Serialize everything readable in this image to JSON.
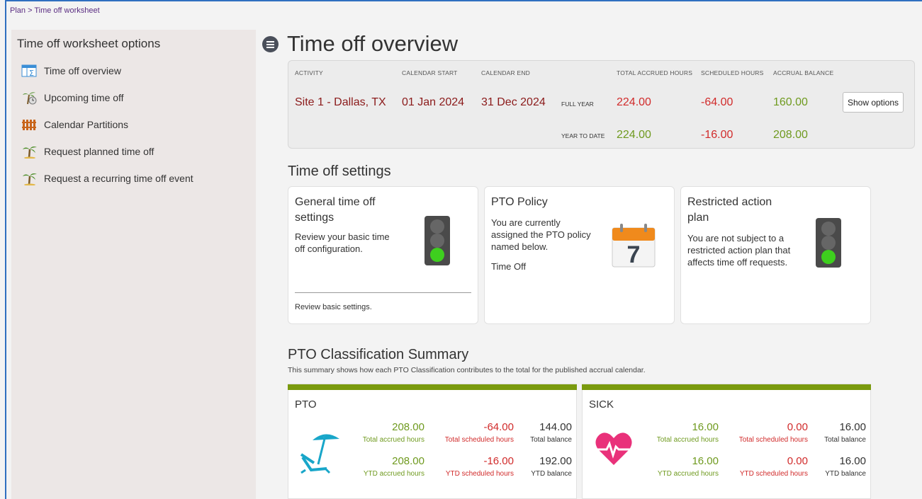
{
  "breadcrumb": "Plan > Time off worksheet",
  "sidebar": {
    "title": "Time off worksheet options",
    "items": [
      {
        "label": "Time off overview",
        "icon": "overview-table-icon"
      },
      {
        "label": "Upcoming time off",
        "icon": "palm-clock-icon"
      },
      {
        "label": "Calendar Partitions",
        "icon": "fence-icon"
      },
      {
        "label": "Request planned time off",
        "icon": "palm-tree-icon"
      },
      {
        "label": "Request a recurring time off event",
        "icon": "palm-tree-icon"
      }
    ]
  },
  "main": {
    "title": "Time off overview",
    "overview": {
      "headers": {
        "activity": "ACTIVITY",
        "calendar_start": "CALENDAR START",
        "calendar_end": "CALENDAR END",
        "total_accrued": "TOTAL ACCRUED HOURS",
        "scheduled": "SCHEDULED HOURS",
        "accrual_balance": "ACCRUAL BALANCE"
      },
      "activity": "Site 1 - Dallas, TX",
      "calendar_start": "01 Jan 2024",
      "calendar_end": "31 Dec 2024",
      "full_year": {
        "label": "FULL YEAR",
        "accrued": "224.00",
        "scheduled": "-64.00",
        "balance": "160.00"
      },
      "year_to_date": {
        "label": "YEAR TO DATE",
        "accrued": "224.00",
        "scheduled": "-16.00",
        "balance": "208.00"
      },
      "show_options": "Show options"
    },
    "settings": {
      "title": "Time off settings",
      "cards": [
        {
          "title_line1": "General time off",
          "title_line2": "settings",
          "desc_line1": "Review your basic time",
          "desc_line2": "off configuration.",
          "link": "Review basic settings.",
          "icon": "traffic-light-icon"
        },
        {
          "title": "PTO Policy",
          "desc_line1": "You are currently",
          "desc_line2": "assigned the PTO policy",
          "desc_line3": "named below.",
          "extra": "Time Off",
          "icon": "calendar-icon",
          "calendar_day": "7"
        },
        {
          "title_line1": "Restricted action",
          "title_line2": "plan",
          "desc_line1": "You are not subject to a",
          "desc_line2": "restricted action plan that",
          "desc_line3": "affects time off requests.",
          "icon": "traffic-light-icon"
        }
      ]
    },
    "classification": {
      "title": "PTO Classification Summary",
      "subtitle": "This summary shows how each PTO Classification contributes to the total for the published accrual calendar.",
      "accent": "#7a9a0e",
      "cards": [
        {
          "name": "PTO",
          "icon": "beach-umbrella-icon",
          "total_accrued": "208.00",
          "total_scheduled": "-64.00",
          "total_balance": "144.00",
          "ytd_accrued": "208.00",
          "ytd_scheduled": "-16.00",
          "ytd_balance": "192.00"
        },
        {
          "name": "SICK",
          "icon": "heart-pulse-icon",
          "total_accrued": "16.00",
          "total_scheduled": "0.00",
          "total_balance": "16.00",
          "ytd_accrued": "16.00",
          "ytd_scheduled": "0.00",
          "ytd_balance": "16.00"
        }
      ],
      "labels": {
        "total_accrued": "Total accrued hours",
        "total_scheduled": "Total scheduled hours",
        "total_balance": "Total balance",
        "ytd_accrued": "YTD accrued hours",
        "ytd_scheduled": "YTD scheduled hours",
        "ytd_balance": "YTD balance"
      }
    }
  },
  "colors": {
    "positive": "#6f9a1f",
    "negative": "#d12b2b",
    "activity": "#8b1a1a",
    "frame": "#2f6fc0"
  }
}
